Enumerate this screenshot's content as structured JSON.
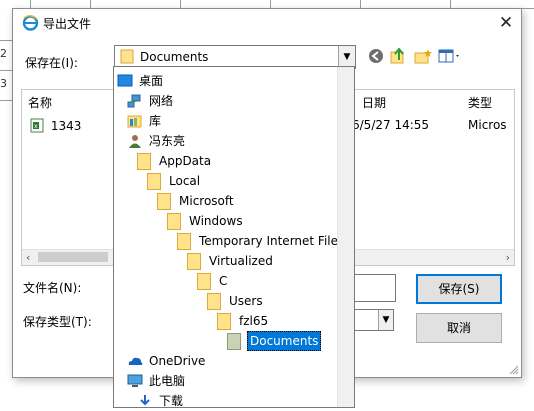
{
  "background": {
    "left_chars": [
      "2",
      "3"
    ]
  },
  "dialog": {
    "title": "导出文件",
    "close_glyph": "✕",
    "save_in_label": "保存在(I):",
    "save_in_value": "Documents",
    "list": {
      "columns": [
        "名称",
        "日期",
        "类型"
      ],
      "rows": [
        {
          "name": "1343",
          "date": "6/5/27 14:55",
          "type": "Micros"
        }
      ]
    },
    "file_name_label": "文件名(N):",
    "file_type_label": "保存类型(T):",
    "save_button": "保存(S)",
    "cancel_button": "取消"
  },
  "dropdown": {
    "items": [
      {
        "label": "桌面",
        "icon": "desktop-icon"
      },
      {
        "label": "网络",
        "icon": "network-icon"
      },
      {
        "label": "库",
        "icon": "library-icon"
      },
      {
        "label": "冯东亮",
        "icon": "user-icon"
      },
      {
        "label": "AppData",
        "icon": "folder-icon"
      },
      {
        "label": "Local",
        "icon": "folder-icon"
      },
      {
        "label": "Microsoft",
        "icon": "folder-icon"
      },
      {
        "label": "Windows",
        "icon": "folder-icon"
      },
      {
        "label": "Temporary Internet Files",
        "icon": "folder-icon"
      },
      {
        "label": "Virtualized",
        "icon": "folder-icon"
      },
      {
        "label": "C",
        "icon": "folder-icon"
      },
      {
        "label": "Users",
        "icon": "folder-icon"
      },
      {
        "label": "fzl65",
        "icon": "folder-icon"
      },
      {
        "label": "Documents",
        "icon": "folder-icon",
        "selected": true
      },
      {
        "label": "OneDrive",
        "icon": "onedrive-icon"
      },
      {
        "label": "此电脑",
        "icon": "computer-icon"
      },
      {
        "label": "下载",
        "icon": "download-icon"
      }
    ]
  },
  "colors": {
    "selection": "#0078d7",
    "folder": "#ffe28a"
  }
}
